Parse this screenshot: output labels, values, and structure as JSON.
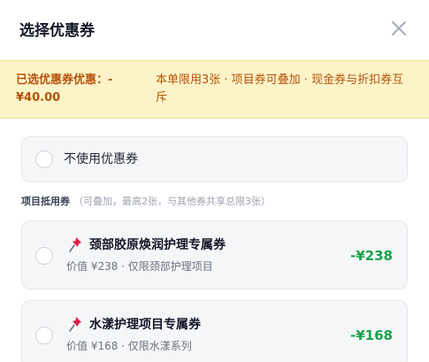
{
  "modal": {
    "title": "选择优惠券"
  },
  "notice": {
    "selected_text": "已选优惠券优惠：-¥40.00",
    "rule_text": "本单限用3张 · 项目券可叠加 · 现金券与折扣券互斥"
  },
  "no_use": {
    "label": "不使用优惠券"
  },
  "section": {
    "title": "项目抵用券",
    "subtitle": "（可叠加，最高2张，与其他券共享总限3张）"
  },
  "coupons": [
    {
      "title": "颈部胶原焕润护理专属券",
      "desc": "价值 ¥238 · 仅限颈部护理项目",
      "amount": "-¥238",
      "icon": "pushpin-icon"
    },
    {
      "title": "水漾护理项目专属券",
      "desc": "价值 ¥168 · 仅限水漾系列",
      "amount": "-¥168",
      "icon": "pushpin-icon"
    }
  ],
  "colors": {
    "notice_bg": "#fdf3c9",
    "notice_text": "#b45309",
    "amount": "#16a34a"
  }
}
